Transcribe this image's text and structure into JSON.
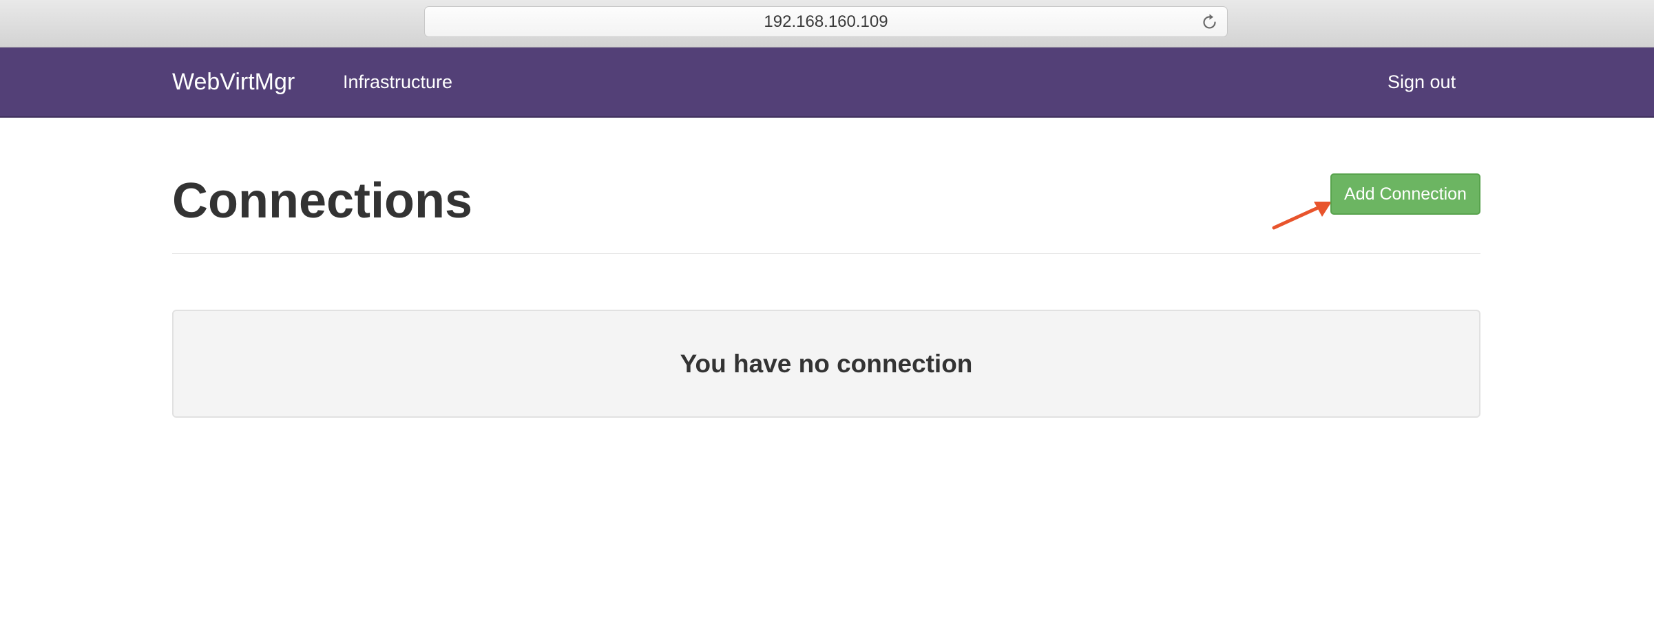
{
  "browser": {
    "address": "192.168.160.109",
    "reload_icon": "reload-icon"
  },
  "navbar": {
    "brand": "WebVirtMgr",
    "links": [
      "Infrastructure"
    ],
    "signout": "Sign out",
    "background": "#534077"
  },
  "page": {
    "title": "Connections",
    "add_button": "Add Connection",
    "add_button_color": "#6cb562",
    "empty_message": "You have no connection"
  },
  "annotation": {
    "arrow_color": "#e8542c",
    "arrow_icon": "arrow-pointer"
  }
}
